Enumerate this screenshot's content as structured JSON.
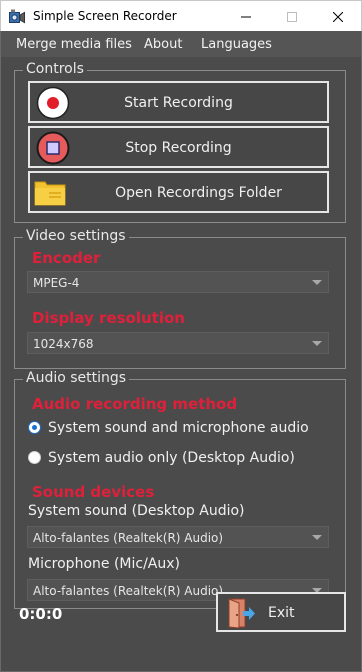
{
  "window": {
    "title": "Simple Screen Recorder"
  },
  "menu": {
    "items": [
      "Merge media files",
      "About",
      "Languages"
    ]
  },
  "controls": {
    "group_title": "Controls",
    "start_label": "Start Recording",
    "stop_label": "Stop Recording",
    "open_folder_label": "Open Recordings Folder"
  },
  "video": {
    "group_title": "Video settings",
    "encoder_label": "Encoder",
    "encoder_value": "MPEG-4",
    "resolution_label": "Display resolution",
    "resolution_value": "1024x768"
  },
  "audio": {
    "group_title": "Audio settings",
    "method_label": "Audio recording method",
    "options": [
      {
        "label": "System sound and microphone audio",
        "selected": true
      },
      {
        "label": "System audio only (Desktop Audio)",
        "selected": false
      }
    ],
    "devices_label": "Sound devices",
    "system_sound_label": "System sound (Desktop Audio)",
    "system_sound_value": "Alto-falantes (Realtek(R) Audio)",
    "microphone_label": "Microphone (Mic/Aux)",
    "microphone_value": "Alto-falantes (Realtek(R) Audio)"
  },
  "footer": {
    "timer": "0:0:0",
    "exit_label": "Exit"
  },
  "colors": {
    "background": "#4b4b4b",
    "menubar": "#555555",
    "accent_red": "#e0203a",
    "radio_blue": "#1a6fd0"
  }
}
